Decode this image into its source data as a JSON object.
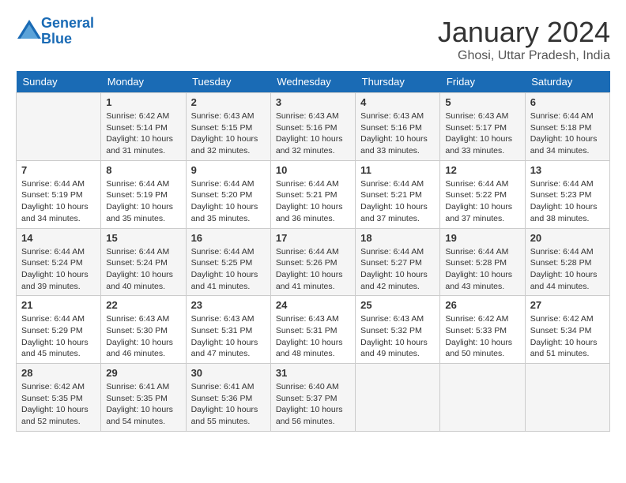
{
  "logo": {
    "line1": "General",
    "line2": "Blue"
  },
  "title": "January 2024",
  "location": "Ghosi, Uttar Pradesh, India",
  "weekdays": [
    "Sunday",
    "Monday",
    "Tuesday",
    "Wednesday",
    "Thursday",
    "Friday",
    "Saturday"
  ],
  "weeks": [
    [
      {
        "day": "",
        "info": ""
      },
      {
        "day": "1",
        "info": "Sunrise: 6:42 AM\nSunset: 5:14 PM\nDaylight: 10 hours\nand 31 minutes."
      },
      {
        "day": "2",
        "info": "Sunrise: 6:43 AM\nSunset: 5:15 PM\nDaylight: 10 hours\nand 32 minutes."
      },
      {
        "day": "3",
        "info": "Sunrise: 6:43 AM\nSunset: 5:16 PM\nDaylight: 10 hours\nand 32 minutes."
      },
      {
        "day": "4",
        "info": "Sunrise: 6:43 AM\nSunset: 5:16 PM\nDaylight: 10 hours\nand 33 minutes."
      },
      {
        "day": "5",
        "info": "Sunrise: 6:43 AM\nSunset: 5:17 PM\nDaylight: 10 hours\nand 33 minutes."
      },
      {
        "day": "6",
        "info": "Sunrise: 6:44 AM\nSunset: 5:18 PM\nDaylight: 10 hours\nand 34 minutes."
      }
    ],
    [
      {
        "day": "7",
        "info": "Sunrise: 6:44 AM\nSunset: 5:19 PM\nDaylight: 10 hours\nand 34 minutes."
      },
      {
        "day": "8",
        "info": "Sunrise: 6:44 AM\nSunset: 5:19 PM\nDaylight: 10 hours\nand 35 minutes."
      },
      {
        "day": "9",
        "info": "Sunrise: 6:44 AM\nSunset: 5:20 PM\nDaylight: 10 hours\nand 35 minutes."
      },
      {
        "day": "10",
        "info": "Sunrise: 6:44 AM\nSunset: 5:21 PM\nDaylight: 10 hours\nand 36 minutes."
      },
      {
        "day": "11",
        "info": "Sunrise: 6:44 AM\nSunset: 5:21 PM\nDaylight: 10 hours\nand 37 minutes."
      },
      {
        "day": "12",
        "info": "Sunrise: 6:44 AM\nSunset: 5:22 PM\nDaylight: 10 hours\nand 37 minutes."
      },
      {
        "day": "13",
        "info": "Sunrise: 6:44 AM\nSunset: 5:23 PM\nDaylight: 10 hours\nand 38 minutes."
      }
    ],
    [
      {
        "day": "14",
        "info": "Sunrise: 6:44 AM\nSunset: 5:24 PM\nDaylight: 10 hours\nand 39 minutes."
      },
      {
        "day": "15",
        "info": "Sunrise: 6:44 AM\nSunset: 5:24 PM\nDaylight: 10 hours\nand 40 minutes."
      },
      {
        "day": "16",
        "info": "Sunrise: 6:44 AM\nSunset: 5:25 PM\nDaylight: 10 hours\nand 41 minutes."
      },
      {
        "day": "17",
        "info": "Sunrise: 6:44 AM\nSunset: 5:26 PM\nDaylight: 10 hours\nand 41 minutes."
      },
      {
        "day": "18",
        "info": "Sunrise: 6:44 AM\nSunset: 5:27 PM\nDaylight: 10 hours\nand 42 minutes."
      },
      {
        "day": "19",
        "info": "Sunrise: 6:44 AM\nSunset: 5:28 PM\nDaylight: 10 hours\nand 43 minutes."
      },
      {
        "day": "20",
        "info": "Sunrise: 6:44 AM\nSunset: 5:28 PM\nDaylight: 10 hours\nand 44 minutes."
      }
    ],
    [
      {
        "day": "21",
        "info": "Sunrise: 6:44 AM\nSunset: 5:29 PM\nDaylight: 10 hours\nand 45 minutes."
      },
      {
        "day": "22",
        "info": "Sunrise: 6:43 AM\nSunset: 5:30 PM\nDaylight: 10 hours\nand 46 minutes."
      },
      {
        "day": "23",
        "info": "Sunrise: 6:43 AM\nSunset: 5:31 PM\nDaylight: 10 hours\nand 47 minutes."
      },
      {
        "day": "24",
        "info": "Sunrise: 6:43 AM\nSunset: 5:31 PM\nDaylight: 10 hours\nand 48 minutes."
      },
      {
        "day": "25",
        "info": "Sunrise: 6:43 AM\nSunset: 5:32 PM\nDaylight: 10 hours\nand 49 minutes."
      },
      {
        "day": "26",
        "info": "Sunrise: 6:42 AM\nSunset: 5:33 PM\nDaylight: 10 hours\nand 50 minutes."
      },
      {
        "day": "27",
        "info": "Sunrise: 6:42 AM\nSunset: 5:34 PM\nDaylight: 10 hours\nand 51 minutes."
      }
    ],
    [
      {
        "day": "28",
        "info": "Sunrise: 6:42 AM\nSunset: 5:35 PM\nDaylight: 10 hours\nand 52 minutes."
      },
      {
        "day": "29",
        "info": "Sunrise: 6:41 AM\nSunset: 5:35 PM\nDaylight: 10 hours\nand 54 minutes."
      },
      {
        "day": "30",
        "info": "Sunrise: 6:41 AM\nSunset: 5:36 PM\nDaylight: 10 hours\nand 55 minutes."
      },
      {
        "day": "31",
        "info": "Sunrise: 6:40 AM\nSunset: 5:37 PM\nDaylight: 10 hours\nand 56 minutes."
      },
      {
        "day": "",
        "info": ""
      },
      {
        "day": "",
        "info": ""
      },
      {
        "day": "",
        "info": ""
      }
    ]
  ]
}
